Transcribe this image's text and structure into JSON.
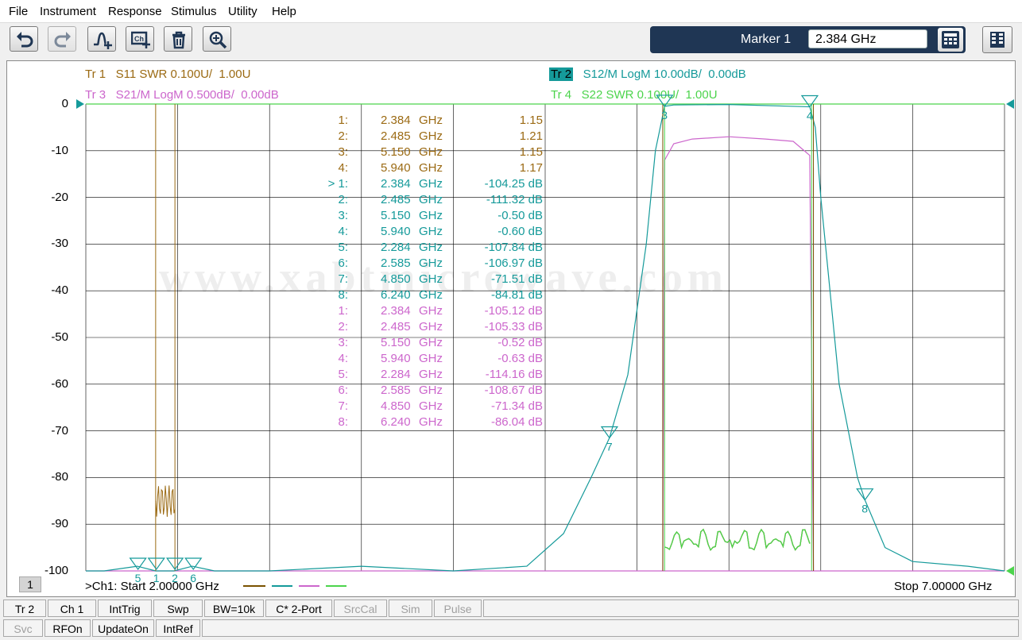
{
  "menu": [
    "File",
    "Instrument",
    "Response",
    "Stimulus",
    "Utility",
    "Help"
  ],
  "marker": {
    "label": "Marker 1",
    "value": "2.384 GHz"
  },
  "traces": {
    "tr1": {
      "id": "Tr 1",
      "desc": "S11 SWR 0.100U/  1.00U",
      "color": "#9b6a13"
    },
    "tr2": {
      "id": "Tr 2",
      "desc": "S12/M LogM 10.00dB/  0.00dB",
      "color": "#159a9a"
    },
    "tr3": {
      "id": "Tr 3",
      "desc": "S21/M LogM 0.500dB/  0.00dB",
      "color": "#cc66cc"
    },
    "tr4": {
      "id": "Tr 4",
      "desc": "S22 SWR 0.100U/  1.00U",
      "color": "#4cd44c"
    }
  },
  "yticks": [
    "0",
    "-10",
    "-20",
    "-30",
    "-40",
    "-50",
    "-60",
    "-70",
    "-80",
    "-90",
    "-100"
  ],
  "marker_table": [
    {
      "n": "1:",
      "f": "2.384",
      "u": "GHz",
      "v": "1.15",
      "t": 1
    },
    {
      "n": "2:",
      "f": "2.485",
      "u": "GHz",
      "v": "1.21",
      "t": 1
    },
    {
      "n": "3:",
      "f": "5.150",
      "u": "GHz",
      "v": "1.15",
      "t": 1
    },
    {
      "n": "4:",
      "f": "5.940",
      "u": "GHz",
      "v": "1.17",
      "t": 1
    },
    {
      "n": "> 1:",
      "f": "2.384",
      "u": "GHz",
      "v": "-104.25 dB",
      "t": 2
    },
    {
      "n": "2:",
      "f": "2.485",
      "u": "GHz",
      "v": "-111.32 dB",
      "t": 2
    },
    {
      "n": "3:",
      "f": "5.150",
      "u": "GHz",
      "v": "-0.50 dB",
      "t": 2
    },
    {
      "n": "4:",
      "f": "5.940",
      "u": "GHz",
      "v": "-0.60 dB",
      "t": 2
    },
    {
      "n": "5:",
      "f": "2.284",
      "u": "GHz",
      "v": "-107.84 dB",
      "t": 2
    },
    {
      "n": "6:",
      "f": "2.585",
      "u": "GHz",
      "v": "-106.97 dB",
      "t": 2
    },
    {
      "n": "7:",
      "f": "4.850",
      "u": "GHz",
      "v": "-71.51 dB",
      "t": 2
    },
    {
      "n": "8:",
      "f": "6.240",
      "u": "GHz",
      "v": "-84.81 dB",
      "t": 2
    },
    {
      "n": "1:",
      "f": "2.384",
      "u": "GHz",
      "v": "-105.12 dB",
      "t": 3
    },
    {
      "n": "2:",
      "f": "2.485",
      "u": "GHz",
      "v": "-105.33 dB",
      "t": 3
    },
    {
      "n": "3:",
      "f": "5.150",
      "u": "GHz",
      "v": "-0.52 dB",
      "t": 3
    },
    {
      "n": "4:",
      "f": "5.940",
      "u": "GHz",
      "v": "-0.63 dB",
      "t": 3
    },
    {
      "n": "5:",
      "f": "2.284",
      "u": "GHz",
      "v": "-114.16 dB",
      "t": 3
    },
    {
      "n": "6:",
      "f": "2.585",
      "u": "GHz",
      "v": "-108.67 dB",
      "t": 3
    },
    {
      "n": "7:",
      "f": "4.850",
      "u": "GHz",
      "v": "-71.34 dB",
      "t": 3
    },
    {
      "n": "8:",
      "f": "6.240",
      "u": "GHz",
      "v": "-86.04 dB",
      "t": 3
    }
  ],
  "watermark": "www.xabtmicrowave.com",
  "footer": {
    "ch": "1",
    "start": ">Ch1:  Start  2.00000 GHz",
    "stop": "Stop  7.00000 GHz"
  },
  "softkeys_row1": [
    {
      "label": "Tr 2",
      "enabled": true
    },
    {
      "label": "Ch 1",
      "enabled": true
    },
    {
      "label": "IntTrig",
      "enabled": true
    },
    {
      "label": "Swp",
      "enabled": true
    },
    {
      "label": "BW=10k",
      "enabled": true
    },
    {
      "label": "C* 2-Port",
      "enabled": true
    },
    {
      "label": "SrcCal",
      "enabled": false
    },
    {
      "label": "Sim",
      "enabled": false
    },
    {
      "label": "Pulse",
      "enabled": false
    }
  ],
  "softkeys_row2": [
    {
      "label": "Svc",
      "enabled": false
    },
    {
      "label": "RFOn",
      "enabled": true
    },
    {
      "label": "UpdateOn",
      "enabled": true
    },
    {
      "label": "IntRef",
      "enabled": true
    }
  ],
  "chart_data": {
    "type": "line",
    "x_range_ghz": [
      2.0,
      7.0
    ],
    "ylim": [
      -100,
      0
    ],
    "grid": true,
    "series": [
      {
        "name": "S12/M LogM",
        "color": "#159a9a",
        "x": [
          2.0,
          2.1,
          2.28,
          2.38,
          2.48,
          2.58,
          2.7,
          3.0,
          3.5,
          4.0,
          4.4,
          4.6,
          4.75,
          4.85,
          4.95,
          5.05,
          5.1,
          5.15,
          5.2,
          5.5,
          5.94,
          5.97,
          6.0,
          6.05,
          6.1,
          6.2,
          6.24,
          6.35,
          6.5,
          6.8,
          7.0
        ],
        "y": [
          -100,
          -100,
          -99,
          -100,
          -100,
          -99,
          -100,
          -100,
          -99,
          -100,
          -99,
          -92,
          -80,
          -71.5,
          -58,
          -30,
          -10,
          -0.5,
          -0.2,
          -0.1,
          -0.6,
          -5,
          -20,
          -40,
          -60,
          -80,
          -84.8,
          -95,
          -98,
          -99,
          -100
        ]
      },
      {
        "name": "S21/M LogM",
        "color": "#cc66cc",
        "x": [
          5.14,
          5.15,
          5.2,
          5.3,
          5.5,
          5.7,
          5.85,
          5.94,
          5.96
        ],
        "y": [
          -100,
          -12,
          -8.5,
          -7.5,
          -7,
          -7.5,
          -8,
          -11,
          -100
        ]
      }
    ],
    "markers": {
      "tr2": [
        {
          "n": 1,
          "f": 2.384,
          "v": -104.25
        },
        {
          "n": 2,
          "f": 2.485,
          "v": -111.32
        },
        {
          "n": 3,
          "f": 5.15,
          "v": -0.5
        },
        {
          "n": 4,
          "f": 5.94,
          "v": -0.6
        },
        {
          "n": 5,
          "f": 2.284,
          "v": -107.84
        },
        {
          "n": 6,
          "f": 2.585,
          "v": -106.97
        },
        {
          "n": 7,
          "f": 4.85,
          "v": -71.51
        },
        {
          "n": 8,
          "f": 6.24,
          "v": -84.81
        }
      ]
    }
  }
}
